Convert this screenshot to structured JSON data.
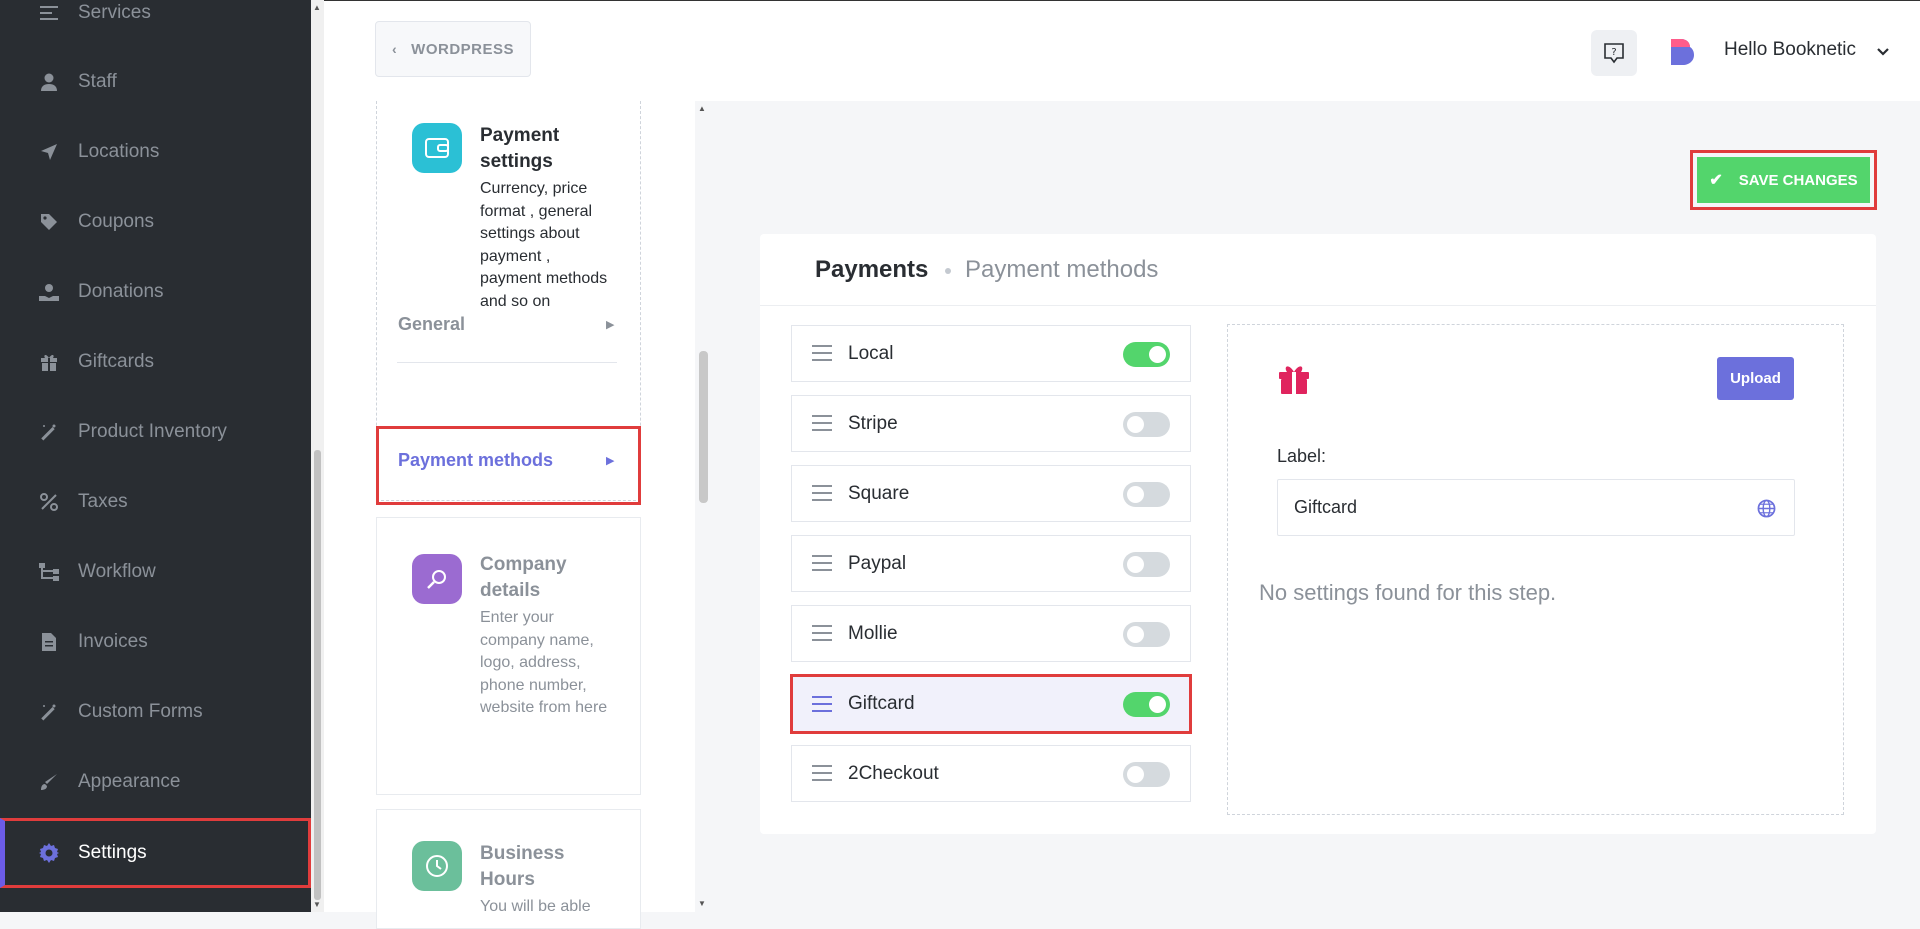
{
  "sidebar": {
    "items": [
      {
        "label": "Services",
        "icon": "list-icon",
        "active": false
      },
      {
        "label": "Staff",
        "icon": "user-icon",
        "active": false
      },
      {
        "label": "Locations",
        "icon": "location-arrow-icon",
        "active": false
      },
      {
        "label": "Coupons",
        "icon": "tag-icon",
        "active": false
      },
      {
        "label": "Donations",
        "icon": "hand-user-icon",
        "active": false
      },
      {
        "label": "Giftcards",
        "icon": "gift-icon",
        "active": false
      },
      {
        "label": "Product Inventory",
        "icon": "magic-wand-icon",
        "active": false
      },
      {
        "label": "Taxes",
        "icon": "percent-icon",
        "active": false
      },
      {
        "label": "Workflow",
        "icon": "sitemap-icon",
        "active": false
      },
      {
        "label": "Invoices",
        "icon": "file-icon",
        "active": false
      },
      {
        "label": "Custom Forms",
        "icon": "magic-wand-icon",
        "active": false
      },
      {
        "label": "Appearance",
        "icon": "brush-icon",
        "active": false
      },
      {
        "label": "Settings",
        "icon": "gear-icon",
        "active": true
      }
    ]
  },
  "topbar": {
    "back_label": "WORDPRESS",
    "user_greeting": "Hello Booknetic"
  },
  "settings_nav": {
    "payment_settings": {
      "title": "Payment settings",
      "desc": "Currency, price format , general settings about payment , payment methods and so on"
    },
    "sub_general": "General",
    "sub_payment_methods": "Payment methods",
    "company_details": {
      "title": "Company details",
      "desc": "Enter your company name, logo, address, phone number, website from here"
    },
    "business_hours": {
      "title": "Business Hours",
      "desc": "You will be able"
    }
  },
  "actions": {
    "save_label": "SAVE CHANGES"
  },
  "panel": {
    "breadcrumb_main": "Payments",
    "breadcrumb_sub": "Payment methods",
    "methods": [
      {
        "name": "Local",
        "enabled": true,
        "selected": false
      },
      {
        "name": "Stripe",
        "enabled": false,
        "selected": false
      },
      {
        "name": "Square",
        "enabled": false,
        "selected": false
      },
      {
        "name": "Paypal",
        "enabled": false,
        "selected": false
      },
      {
        "name": "Mollie",
        "enabled": false,
        "selected": false
      },
      {
        "name": "Giftcard",
        "enabled": true,
        "selected": true
      },
      {
        "name": "2Checkout",
        "enabled": false,
        "selected": false
      }
    ],
    "detail": {
      "upload_label": "Upload",
      "label_caption": "Label:",
      "label_value": "Giftcard",
      "empty_message": "No settings found for this step."
    }
  },
  "colors": {
    "sidebar_bg": "#292d32",
    "accent": "#6c70dc",
    "success": "#53d56c",
    "highlight_border": "#e03c3c"
  }
}
